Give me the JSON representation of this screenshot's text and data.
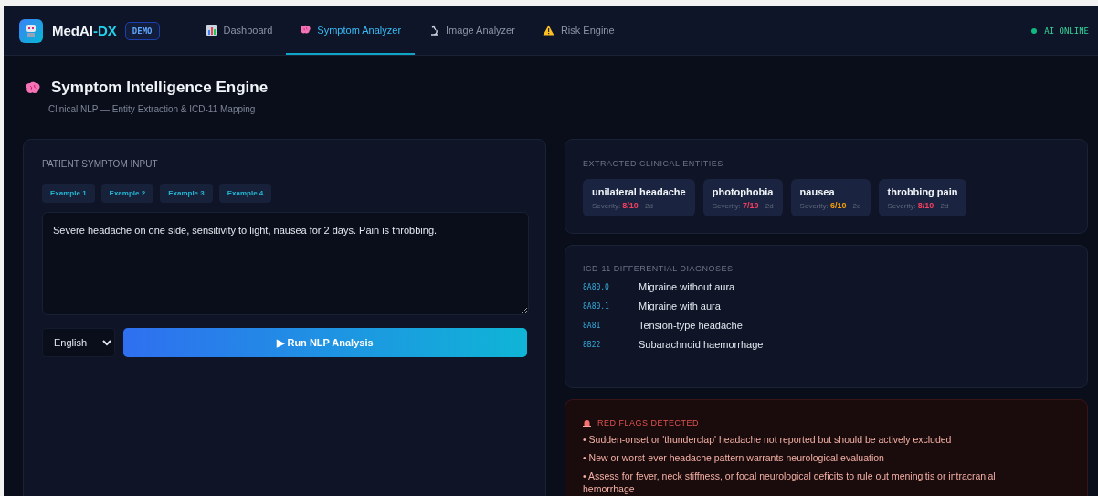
{
  "app": {
    "name": "MedAI",
    "name_suffix": "-DX",
    "badge": "DEMO"
  },
  "tabs": [
    {
      "label": "Dashboard",
      "selected": false
    },
    {
      "label": "Symptom Analyzer",
      "selected": true
    },
    {
      "label": "Image Analyzer",
      "selected": false
    },
    {
      "label": "Risk Engine",
      "selected": false
    }
  ],
  "status": {
    "label": "AI ONLINE",
    "color": "#10b981"
  },
  "header": {
    "title": "Symptom Intelligence Engine",
    "subtitle": "Clinical NLP — Entity Extraction & ICD-11 Mapping"
  },
  "input_panel": {
    "heading": "PATIENT SYMPTOM INPUT",
    "examples": [
      "Example 1",
      "Example 2",
      "Example 3",
      "Example 4"
    ],
    "text": "Severe headache on one side, sensitivity to light, nausea for 2 days. Pain is throbbing.",
    "language": "English",
    "run_button": "▶ Run NLP Analysis"
  },
  "entities": {
    "heading": "EXTRACTED CLINICAL ENTITIES",
    "items": [
      {
        "name": "unilateral headache",
        "severity_label": "Severity:",
        "severity": "8/10",
        "duration": "· 2d",
        "color": "#f43f5e"
      },
      {
        "name": "photophobia",
        "severity_label": "Severity:",
        "severity": "7/10",
        "duration": "· 2d",
        "color": "#f43f5e"
      },
      {
        "name": "nausea",
        "severity_label": "Severity:",
        "severity": "6/10",
        "duration": "· 2d",
        "color": "#f59e0b"
      },
      {
        "name": "throbbing pain",
        "severity_label": "Severity:",
        "severity": "8/10",
        "duration": "· 2d",
        "color": "#f43f5e"
      }
    ]
  },
  "diagnoses": {
    "heading": "ICD-11 DIFFERENTIAL DIAGNOSES",
    "items": [
      {
        "code": "8A80.0",
        "name": "Migraine without aura"
      },
      {
        "code": "8A80.1",
        "name": "Migraine with aura"
      },
      {
        "code": "8A81",
        "name": "Tension-type headache"
      },
      {
        "code": "8B22",
        "name": "Subarachnoid haemorrhage"
      }
    ]
  },
  "red_flags": {
    "heading": "RED FLAGS DETECTED",
    "items": [
      "• Sudden-onset or 'thunderclap' headache not reported but should be actively excluded",
      "• New or worst-ever headache pattern warrants neurological evaluation",
      "• Assess for fever, neck stiffness, or focal neurological deficits to rule out meningitis or intracranial hemorrhage"
    ]
  }
}
